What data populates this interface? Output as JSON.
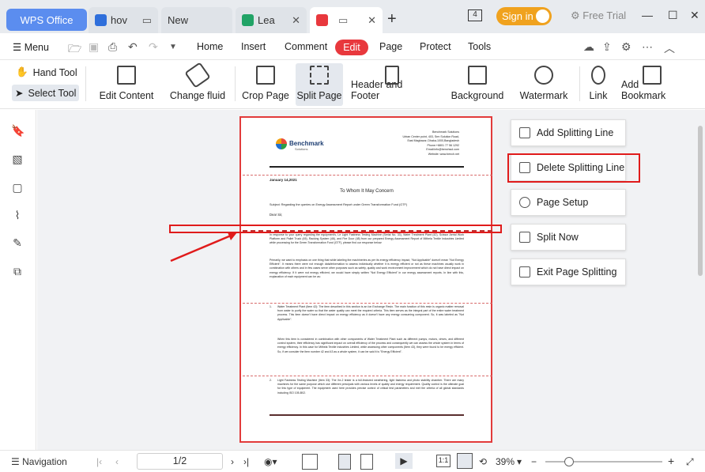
{
  "tabs": [
    {
      "label": "WPS Office"
    },
    {
      "label": "hov"
    },
    {
      "label": "New"
    },
    {
      "label": "Lea"
    },
    {
      "label": ""
    }
  ],
  "titlebar": {
    "signin": "Sign in",
    "free_trial": "Free Trial",
    "tab_count": "4"
  },
  "menu": {
    "menu_label": "Menu",
    "items": [
      "Home",
      "Insert",
      "Comment",
      "Edit",
      "Page",
      "Protect",
      "Tools"
    ]
  },
  "ribbon": {
    "hand_tool": "Hand Tool",
    "select_tool": "Select Tool",
    "buttons": [
      "Edit Content",
      "Change fluid",
      "Crop Page",
      "Split Page",
      "Header and Footer",
      "Background",
      "Watermark",
      "Link",
      "Add Bookmark"
    ]
  },
  "split_menu": {
    "items": [
      "Add Splitting Line",
      "Delete Splitting Line",
      "Page Setup",
      "Split Now",
      "Exit Page Splitting"
    ]
  },
  "document": {
    "company": "Benchmark Solutions",
    "logo_text": "Benchmark",
    "logo_sub": "Solutions",
    "addr1": "Benchmark Solutions",
    "addr2": "Urban Center point, 403, Srm Solution Road,",
    "addr3": "East Magbazar, Dhaka-1000,Bangladesh",
    "addr4": "Phone:+8801 77 56 1292",
    "addr5": "Email:info@benchsol.com",
    "addr6": "Website: www.bench.net",
    "date": "January 14,2021",
    "heading": "To Whom It May Concern",
    "subject": "Subject: Regarding the queries on Energy Assessment Report under Green Transformation Fund (GTF)",
    "salutation": "Dear Sir,",
    "p1": "In response to your query regarding the equipment's, Le Light Fastness Testing Machine (Serial No. 33), Water Treatment Plant (42), Scissor Aerial Work Platform and Pallet Truck (45), Racking System (46), and Fire Door (48) from our prepared Energy Assessment Report of Mithela Textile Industries Limited while processing for the Green Transformation Fund (GTF), please find our response below:",
    "p2": "Primarily, we want to emphasis on one thing that while labeling the machineries as per its energy efficiency impact, \"Not Applicable\" doesn't mean \"Not Energy Efficient\". It means there were not enough data/information to assess individually whether it is energy efficient or not as these machines usually work in combination with others and in few cases serve other purposes such as safety, quality and work environment improvement which do not have direct impact on energy efficiency. If it were not energy efficient, we would have simply written \"Not Energy Efficient\" in our energy assessment reports. In line with this, explanation of each equipment can be as:",
    "item1": "Water Treatment Plant (Item 42): The item described in this section is an Ion Exchange Resin. The main function of this resin is organic matter removal from water to purify the water so that the water quality can meet the required criteria. This item serves as the integral part of the entire water treatment process. This item doesn't have direct impact on energy efficiency as it doesn't have any energy consuming component. So, it was labeled as \"Not Applicable\".",
    "item1b": "When this item is considered in combination with other components of Water Treatment Plant such as different pumps, motors, drives, and different control system, their efficiency has significant impact on overall efficiency of the process and consequently we can assess the whole system in terms of energy efficiency. In this case for Mithela Textile Industries Limited, while assessing other components (Item 43), they were found to be energy efficient. So, if we consider the item number 42 and 43 as a whole system, it can be said it is \"Energy Efficient\".",
    "item2": "Light Fastness Testing Machine (Item 33): The Xe-2 tester is a full-featured weathering, light fastness and photo stability chamber. There are many machines for the same purpose which use different principals with various levels of quality and energy requirement. Quality control is the ultimate goal for this type of equipment. The equipment used here provides precise control of critical test parameters and met the criteria of all global standards including ISO 105-B02."
  },
  "status": {
    "navigation": "Navigation",
    "page": "1/2",
    "zoom": "39%"
  }
}
